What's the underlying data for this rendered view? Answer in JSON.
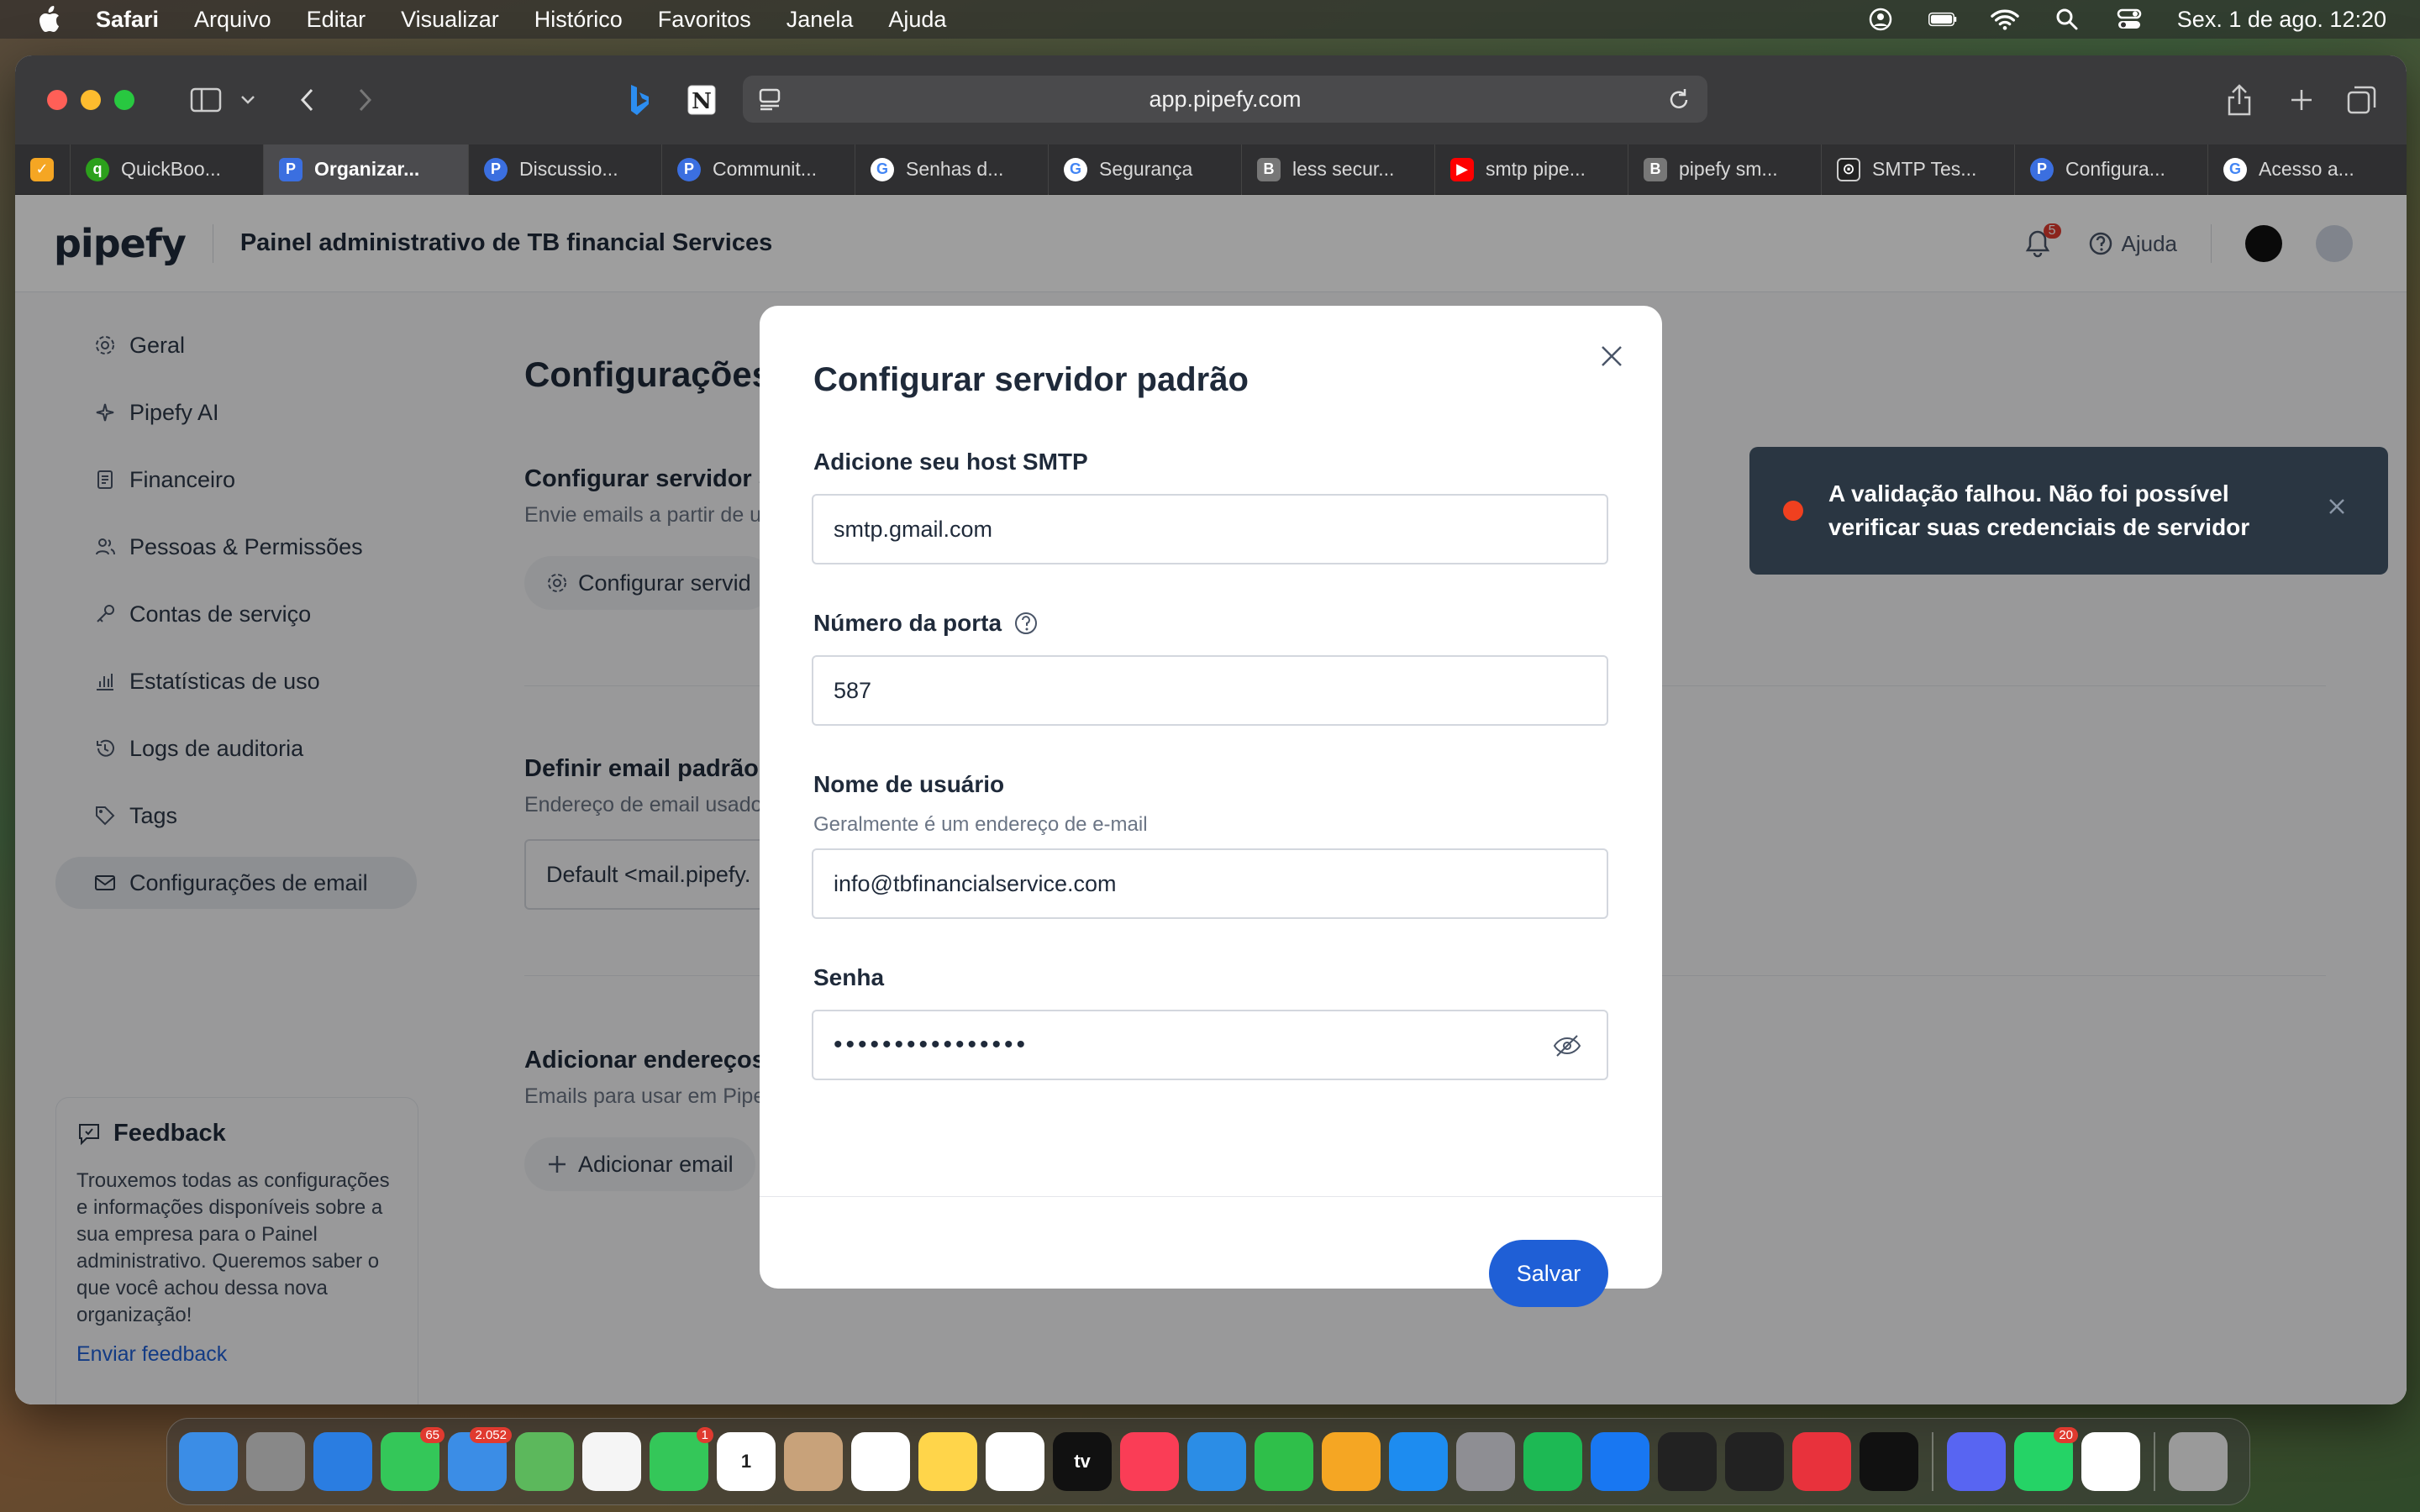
{
  "menubar": {
    "app": "Safari",
    "items": [
      "Arquivo",
      "Editar",
      "Visualizar",
      "Histórico",
      "Favoritos",
      "Janela",
      "Ajuda"
    ],
    "datetime": "Sex. 1 de ago.  12:20"
  },
  "browser": {
    "url": "app.pipefy.com",
    "tabs": [
      {
        "label": "",
        "icon": "safari-tab-icon",
        "color": "#f5a623"
      },
      {
        "label": "QuickBoo...",
        "icon": "quickbooks-icon",
        "color": "#2ca01c"
      },
      {
        "label": "Organizar...",
        "icon": "pipefy-icon",
        "color": "#3b6fe0",
        "active": true
      },
      {
        "label": "Discussio...",
        "icon": "pipefy-icon",
        "color": "#3b6fe0"
      },
      {
        "label": "Communit...",
        "icon": "pipefy-icon",
        "color": "#3b6fe0"
      },
      {
        "label": "Senhas d...",
        "icon": "google-icon",
        "color": "#ffffff"
      },
      {
        "label": "Segurança",
        "icon": "google-icon",
        "color": "#ffffff"
      },
      {
        "label": "less secur...",
        "icon": "bing-b-icon",
        "color": "#777777"
      },
      {
        "label": "smtp pipe...",
        "icon": "youtube-icon",
        "color": "#ff0000"
      },
      {
        "label": "pipefy sm...",
        "icon": "bing-b-icon",
        "color": "#777777"
      },
      {
        "label": "SMTP Tes...",
        "icon": "smtp-test-icon",
        "color": "#222222"
      },
      {
        "label": "Configura...",
        "icon": "pipefy-icon",
        "color": "#3b6fe0"
      },
      {
        "label": "Acesso a...",
        "icon": "google-icon",
        "color": "#ffffff"
      }
    ]
  },
  "header": {
    "logo": "pipefy",
    "title": "Painel administrativo de TB financial Services",
    "notifications": "5",
    "help": "Ajuda"
  },
  "sidebar": {
    "items": [
      {
        "label": "Geral",
        "icon": "gear-icon"
      },
      {
        "label": "Pipefy AI",
        "icon": "sparkle-icon"
      },
      {
        "label": "Financeiro",
        "icon": "receipt-icon"
      },
      {
        "label": "Pessoas & Permissões",
        "icon": "people-icon"
      },
      {
        "label": "Contas de serviço",
        "icon": "key-icon"
      },
      {
        "label": "Estatísticas de uso",
        "icon": "chart-icon"
      },
      {
        "label": "Logs de auditoria",
        "icon": "history-icon"
      },
      {
        "label": "Tags",
        "icon": "tag-icon"
      },
      {
        "label": "Configurações de email",
        "icon": "mail-icon",
        "active": true
      }
    ],
    "feedback": {
      "title": "Feedback",
      "text": "Trouxemos todas as configurações e informações disponíveis sobre a sua empresa para o Painel administrativo. Queremos saber o que você achou dessa nova organização!",
      "link": "Enviar feedback"
    }
  },
  "main": {
    "title": "Configurações d",
    "section1": {
      "title": "Configurar servidor S",
      "desc": "Envie emails a partir de u",
      "button": "Configurar servid"
    },
    "section2": {
      "title": "Definir email padrão",
      "desc": "Endereço de email usado",
      "value": "Default <mail.pipefy."
    },
    "section3": {
      "title": "Adicionar endereços",
      "desc": "Emails para usar em Pipe",
      "button": "Adicionar email"
    }
  },
  "modal": {
    "title": "Configurar servidor padrão",
    "host_label": "Adicione seu host SMTP",
    "host_value": "smtp.gmail.com",
    "port_label": "Número da porta",
    "port_value": "587",
    "user_label": "Nome de usuário",
    "user_hint": "Geralmente é um endereço de e-mail",
    "user_value": "info@tbfinancialservice.com",
    "password_label": "Senha",
    "password_value": "••••••••••••••••",
    "save": "Salvar"
  },
  "toast": {
    "message": "A validação falhou. Não foi possível verificar suas credenciais de servidor",
    "color": "#f0401f"
  },
  "dock": {
    "apps": [
      {
        "name": "finder",
        "color": "#3b8de6"
      },
      {
        "name": "launchpad",
        "color": "#888888"
      },
      {
        "name": "safari",
        "color": "#2a7de1"
      },
      {
        "name": "messages",
        "color": "#34c759",
        "badge": "65"
      },
      {
        "name": "mail",
        "color": "#3b8de6",
        "badge": "2.052"
      },
      {
        "name": "maps",
        "color": "#5cb85c"
      },
      {
        "name": "photos",
        "color": "#f5f5f5"
      },
      {
        "name": "facetime",
        "color": "#34c759",
        "badge": "1"
      },
      {
        "name": "calendar",
        "color": "#ffffff",
        "label": "1"
      },
      {
        "name": "contacts",
        "color": "#c8a27a"
      },
      {
        "name": "reminders",
        "color": "#ffffff"
      },
      {
        "name": "notes",
        "color": "#ffd54a"
      },
      {
        "name": "freeform",
        "color": "#ffffff"
      },
      {
        "name": "tv",
        "color": "#111111",
        "label": "tv"
      },
      {
        "name": "music",
        "color": "#fa3d56"
      },
      {
        "name": "keynote",
        "color": "#2b8de6"
      },
      {
        "name": "numbers",
        "color": "#2fbf4a"
      },
      {
        "name": "pages",
        "color": "#f5a623"
      },
      {
        "name": "app-store",
        "color": "#1d8cf0"
      },
      {
        "name": "system-settings",
        "color": "#8e8e93"
      },
      {
        "name": "spotify",
        "color": "#1db954"
      },
      {
        "name": "facebook",
        "color": "#1877f2"
      },
      {
        "name": "acrobat",
        "color": "#222222"
      },
      {
        "name": "sketch-app",
        "color": "#222222"
      },
      {
        "name": "deezer-app",
        "color": "#e8323c"
      },
      {
        "name": "triangle-app",
        "color": "#111111"
      },
      {
        "name": "discord",
        "color": "#5865f2"
      },
      {
        "name": "whatsapp",
        "color": "#25d366",
        "badge": "20"
      },
      {
        "name": "chrome",
        "color": "#ffffff"
      },
      {
        "name": "trash",
        "color": "#9a9a9a"
      }
    ]
  }
}
